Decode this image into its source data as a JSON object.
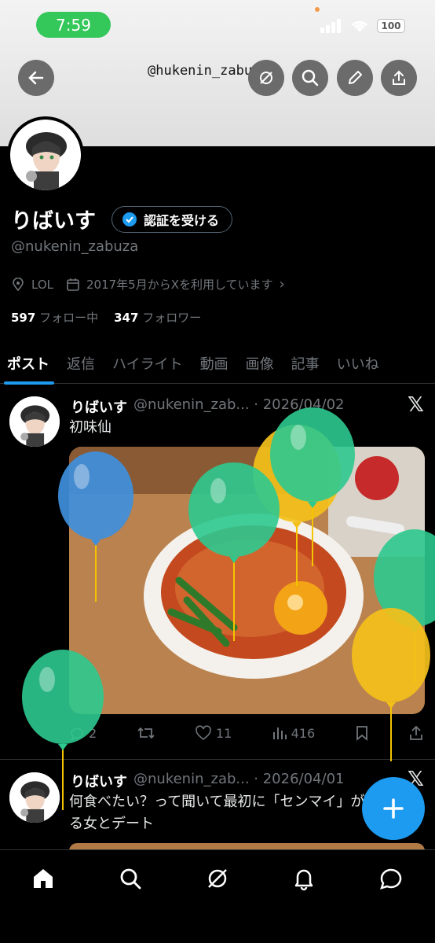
{
  "status_bar": {
    "time": "7:59",
    "battery": "100"
  },
  "header": {
    "handle_overlay": "@hukenin_zabuza"
  },
  "profile": {
    "name": "りばいす",
    "verify_label": "認証を受ける",
    "handle": "@nukenin_zabuza",
    "location": "LOL",
    "joined": "2017年5月からXを利用しています",
    "following_count": "597",
    "following_label": "フォロー中",
    "followers_count": "347",
    "followers_label": "フォロワー"
  },
  "tabs": [
    "ポスト",
    "返信",
    "ハイライト",
    "動画",
    "画像",
    "記事",
    "いいね"
  ],
  "posts": [
    {
      "name": "りばいす",
      "handle_date": "@nukenin_zab... · 2026/04/02",
      "text": "初味仙",
      "replies": "2",
      "likes": "11",
      "views": "416"
    },
    {
      "name": "りばいす",
      "handle_date": "@nukenin_zab... · 2026/04/01",
      "text": "何食べたい？って聞いて最初に「センマイ」が出てくる女とデート"
    }
  ],
  "colors": {
    "accent": "#1d9bf0",
    "verified": "#1d9bf0",
    "status_green": "#34c759"
  },
  "icons": [
    "back-icon",
    "explore-icon",
    "search-icon",
    "edit-icon",
    "share-icon",
    "location-icon",
    "calendar-icon",
    "x-logo-icon",
    "reply-icon",
    "repost-icon",
    "like-icon",
    "views-icon",
    "bookmark-icon",
    "plus-icon",
    "home-icon",
    "grok-icon",
    "bell-icon",
    "messages-icon"
  ]
}
